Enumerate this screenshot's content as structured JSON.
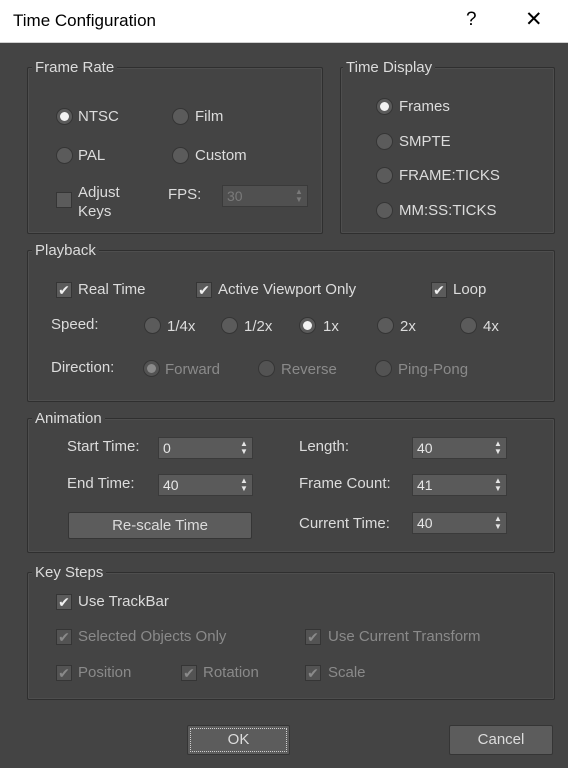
{
  "window": {
    "title": "Time Configuration",
    "help": "?",
    "close": "✕"
  },
  "frame_rate": {
    "legend": "Frame Rate",
    "ntsc": "NTSC",
    "film": "Film",
    "pal": "PAL",
    "custom": "Custom",
    "adjust_keys_line1": "Adjust",
    "adjust_keys_line2": "Keys",
    "fps_label": "FPS:",
    "fps_value": "30"
  },
  "time_display": {
    "legend": "Time Display",
    "frames": "Frames",
    "smpte": "SMPTE",
    "frame_ticks": "FRAME:TICKS",
    "mm_ss_ticks": "MM:SS:TICKS"
  },
  "playback": {
    "legend": "Playback",
    "real_time": "Real Time",
    "active_viewport_only": "Active Viewport Only",
    "loop": "Loop",
    "speed_label": "Speed:",
    "speed_quarter": "1/4x",
    "speed_half": "1/2x",
    "speed_1x": "1x",
    "speed_2x": "2x",
    "speed_4x": "4x",
    "direction_label": "Direction:",
    "forward": "Forward",
    "reverse": "Reverse",
    "ping_pong": "Ping-Pong"
  },
  "animation": {
    "legend": "Animation",
    "start_time_label": "Start Time:",
    "start_time_value": "0",
    "end_time_label": "End Time:",
    "end_time_value": "40",
    "length_label": "Length:",
    "length_value": "40",
    "frame_count_label": "Frame Count:",
    "frame_count_value": "41",
    "current_time_label": "Current Time:",
    "current_time_value": "40",
    "rescale_button": "Re-scale Time"
  },
  "key_steps": {
    "legend": "Key Steps",
    "use_trackbar": "Use TrackBar",
    "selected_objects_only": "Selected Objects Only",
    "use_current_transform": "Use Current Transform",
    "position": "Position",
    "rotation": "Rotation",
    "scale": "Scale"
  },
  "buttons": {
    "ok": "OK",
    "cancel": "Cancel"
  },
  "glyphs": {
    "check": "✔",
    "spin": "▲▼"
  }
}
